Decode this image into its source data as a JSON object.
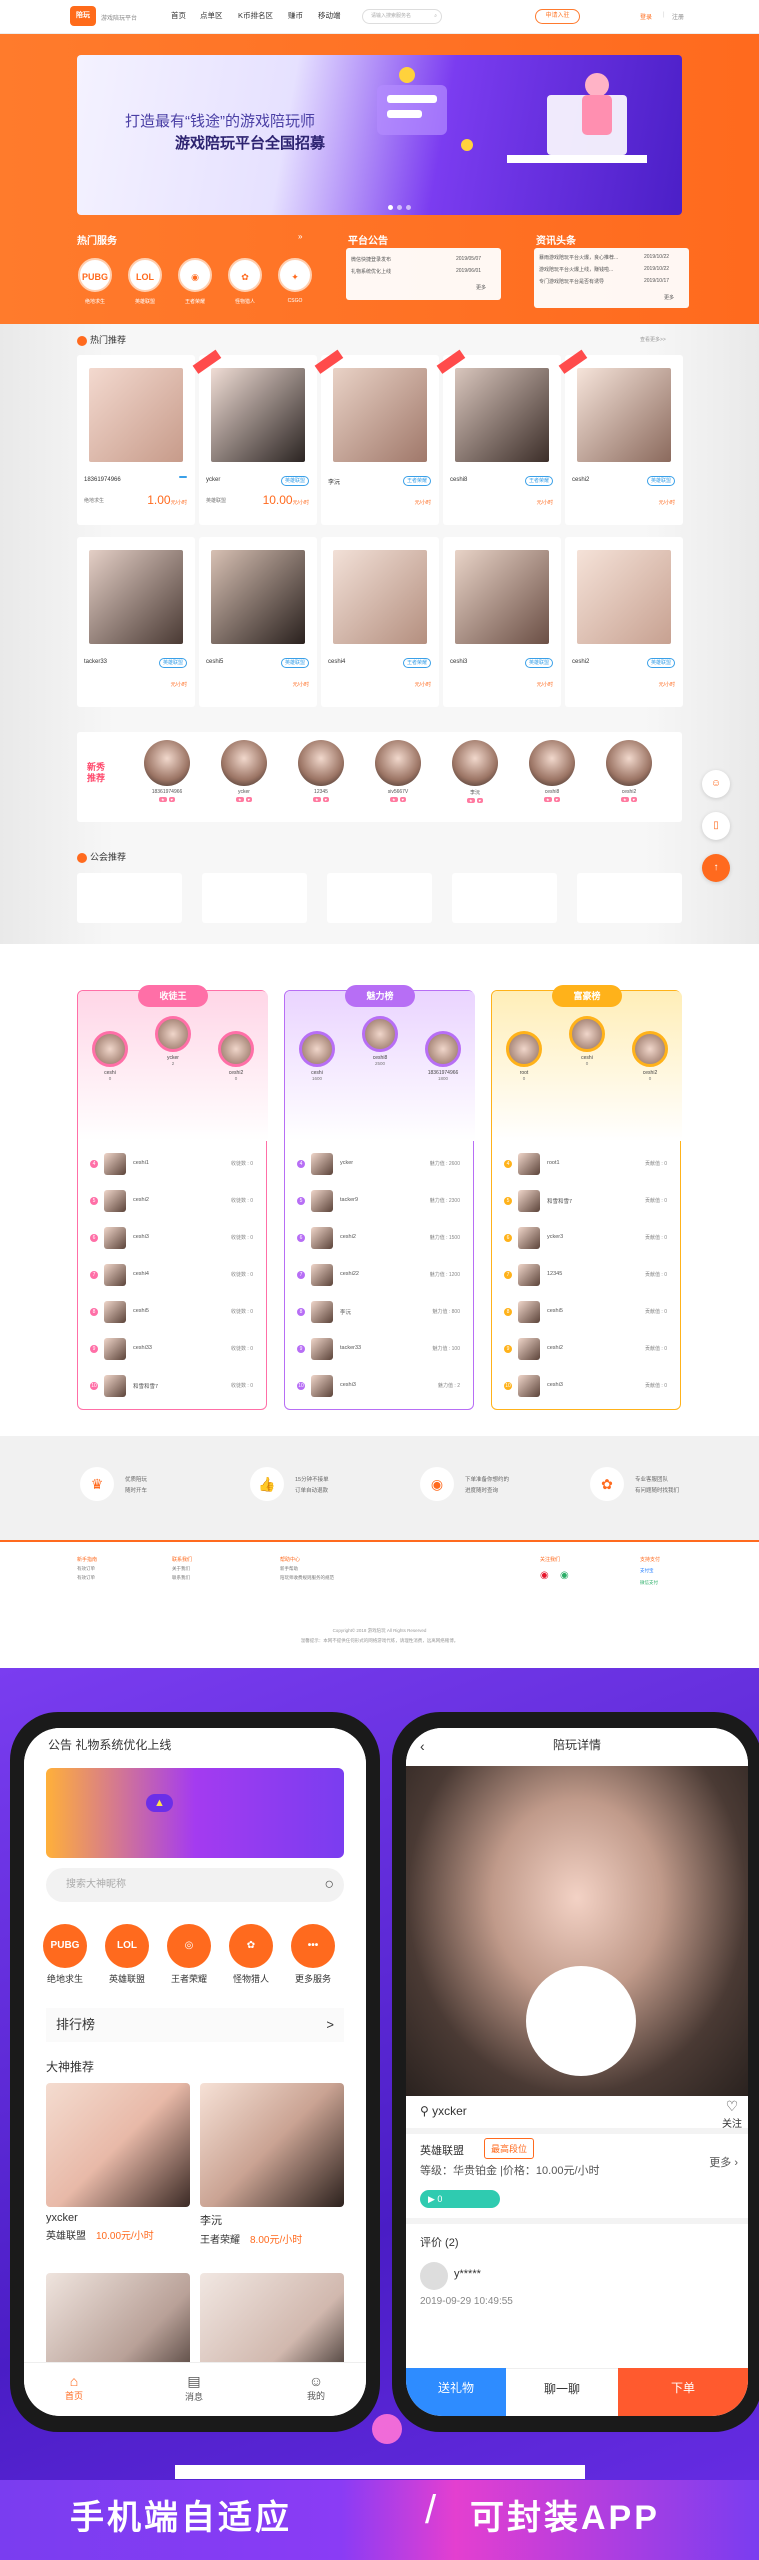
{
  "header": {
    "logo": "陪玩",
    "logo_sub": "游戏陪玩平台",
    "nav": [
      "首页",
      "点单区",
      "K币排名区",
      "赚币",
      "移动端"
    ],
    "search_placeholder": "请输入搜索服务名",
    "join": "申请入驻",
    "login": "登录",
    "register": "注册"
  },
  "banner": {
    "line1": "打造最有“钱途”的游戏陪玩师",
    "line2": "游戏陪玩平台全国招募"
  },
  "services": {
    "title": "热门服务",
    "items": [
      {
        "icon": "PUBG",
        "label": "绝地求生"
      },
      {
        "icon": "LOL",
        "label": "英雄联盟"
      },
      {
        "icon": "◉",
        "label": "王者荣耀"
      },
      {
        "icon": "✿",
        "label": "怪物猎人"
      },
      {
        "icon": "✦",
        "label": "CSGO"
      }
    ]
  },
  "notice": {
    "title": "平台公告",
    "items": [
      {
        "t": "微信快捷登录发布",
        "d": "2019/05/07"
      },
      {
        "t": "礼物系统优化上线",
        "d": "2019/06/01"
      }
    ],
    "more": "更多"
  },
  "news": {
    "title": "资讯头条",
    "items": [
      {
        "t": "暴雨游戏陪玩平台火爆，良心推荐...",
        "d": "2019/10/22"
      },
      {
        "t": "游戏陪玩平台火爆上线，赚钱啦...",
        "d": "2019/10/22"
      },
      {
        "t": "专门游戏陪玩平台是否有诱导",
        "d": "2019/10/17"
      }
    ],
    "more": "更多"
  },
  "hot": {
    "title": "热门推荐",
    "more": "查看更多>>",
    "cards": [
      {
        "name": "18361974966",
        "badge": "",
        "game": "绝地求生",
        "price": "1.00",
        "unit": "元/小时"
      },
      {
        "name": "ycker",
        "badge": "英雄联盟",
        "game": "英雄联盟",
        "price": "10.00",
        "unit": "元/小时"
      },
      {
        "name": "李沅",
        "badge": "王者荣耀",
        "game": "",
        "price": "0",
        "unit": "元/小时"
      },
      {
        "name": "ceshi8",
        "badge": "王者荣耀",
        "game": "",
        "price": "0",
        "unit": "元/小时"
      },
      {
        "name": "ceshi2",
        "badge": "英雄联盟",
        "game": "",
        "price": "0",
        "unit": "元/小时"
      },
      {
        "name": "tacker33",
        "badge": "英雄联盟",
        "game": "",
        "price": "0",
        "unit": "元/小时"
      },
      {
        "name": "ceshi5",
        "badge": "英雄联盟",
        "game": "",
        "price": "0",
        "unit": "元/小时"
      },
      {
        "name": "ceshi4",
        "badge": "王者荣耀",
        "game": "",
        "price": "0",
        "unit": "元/小时"
      },
      {
        "name": "ceshi3",
        "badge": "英雄联盟",
        "game": "",
        "price": "0",
        "unit": "元/小时"
      },
      {
        "name": "ceshi2",
        "badge": "英雄联盟",
        "game": "",
        "price": "0",
        "unit": "元/小时"
      }
    ]
  },
  "newrec": {
    "title": "新秀推荐",
    "items": [
      "18361974966",
      "ycker",
      "12345",
      "siv5667V",
      "李沅",
      "ceshi8",
      "ceshi2"
    ]
  },
  "guild": {
    "title": "公会推荐"
  },
  "ranks": [
    {
      "title": "收徒王",
      "top3": [
        {
          "n": "ceshi",
          "v": "0"
        },
        {
          "n": "ycker",
          "v": "2"
        },
        {
          "n": "ceshi2",
          "v": "0"
        }
      ],
      "rows": [
        {
          "n": "ceshi1",
          "v": "0"
        },
        {
          "n": "ceshi2",
          "v": "0"
        },
        {
          "n": "ceshi3",
          "v": "0"
        },
        {
          "n": "ceshi4",
          "v": "0"
        },
        {
          "n": "ceshi5",
          "v": "0"
        },
        {
          "n": "ceshi33",
          "v": "0"
        },
        {
          "n": "和雪和雪7",
          "v": "0"
        }
      ],
      "vlabel": "收徒数"
    },
    {
      "title": "魅力榜",
      "top3": [
        {
          "n": "ceshi",
          "v": "1600"
        },
        {
          "n": "ceshi8",
          "v": "2500"
        },
        {
          "n": "18361974966",
          "v": "1800"
        }
      ],
      "rows": [
        {
          "n": "ycker",
          "v": "2600"
        },
        {
          "n": "tacker9",
          "v": "2300"
        },
        {
          "n": "ceshi2",
          "v": "1500"
        },
        {
          "n": "ceshi22",
          "v": "1200"
        },
        {
          "n": "李沅",
          "v": "800"
        },
        {
          "n": "tacker33",
          "v": "100"
        },
        {
          "n": "ceshi3",
          "v": "2"
        }
      ],
      "vlabel": "魅力值"
    },
    {
      "title": "富豪榜",
      "top3": [
        {
          "n": "root",
          "v": "0"
        },
        {
          "n": "ceshi",
          "v": "0"
        },
        {
          "n": "ceshi2",
          "v": "0"
        }
      ],
      "rows": [
        {
          "n": "root1",
          "v": "0"
        },
        {
          "n": "和雪和雪7",
          "v": "0"
        },
        {
          "n": "ycker3",
          "v": "0"
        },
        {
          "n": "12345",
          "v": "0"
        },
        {
          "n": "ceshi5",
          "v": "0"
        },
        {
          "n": "ceshi2",
          "v": "0"
        },
        {
          "n": "ceshi3",
          "v": "0"
        }
      ],
      "vlabel": "贡献值"
    }
  ],
  "features": [
    {
      "icon": "♛",
      "a": "优质陪玩",
      "b": "随时开车"
    },
    {
      "icon": "👍",
      "a": "15分钟不接单",
      "b": "订单自动退款"
    },
    {
      "icon": "◉",
      "a": "下单准备你想约的",
      "b": "进度随时查询"
    },
    {
      "icon": "✿",
      "a": "专业客服团队",
      "b": "有问题随时找我们"
    }
  ],
  "footer": {
    "cols": [
      {
        "t": "新手指南",
        "s": [
          "有效订单",
          "有效订单"
        ]
      },
      {
        "t": "联系我们",
        "s": [
          "关于我们",
          "联系我们"
        ]
      },
      {
        "t": "帮助中心",
        "s": [
          "新手帮助",
          "陪玩师收费规则服务的规范"
        ]
      },
      {
        "t": "关注我们",
        "s": []
      },
      {
        "t": "支持支付",
        "s": [
          "支付宝",
          "微信支付"
        ]
      }
    ],
    "copy1": "Copyright© 2018 游戏陪玩 All Rights Reserved",
    "copy2": "温馨提示：本网不提供任何形式的网络游戏代练，请理性消费，远离网络赌博。"
  },
  "mobile": {
    "notice": "公告   礼物系统优化上线",
    "detail_title": "陪玩详情",
    "search": "搜索大神昵称",
    "icons": [
      {
        "i": "PUBG",
        "l": "绝地求生"
      },
      {
        "i": "LOL",
        "l": "英雄联盟"
      },
      {
        "i": "◎",
        "l": "王者荣耀"
      },
      {
        "i": "✿",
        "l": "怪物猎人"
      },
      {
        "i": "•••",
        "l": "更多服务"
      }
    ],
    "rank": "排行榜",
    "gods": "大神推荐",
    "cards": [
      {
        "n": "yxcker",
        "g": "英雄联盟",
        "p": "10.00元/小时"
      },
      {
        "n": "李沅",
        "g": "王者荣耀",
        "p": "8.00元/小时"
      }
    ],
    "tabs": [
      "首页",
      "消息",
      "我的"
    ],
    "d_name": "yxcker",
    "d_follow": "关注",
    "d_game": "英雄联盟",
    "d_rank": "最高段位",
    "d_level": "等级：华贵铂金 |价格：10.00元/小时",
    "d_more": "更多",
    "d_voice": "0",
    "d_eval": "评价 (2)",
    "d_user": "y*****",
    "d_date": "2019-09-29 10:49:55",
    "d_gift": "送礼物",
    "d_chat": "聊一聊",
    "d_order": "下单"
  },
  "slogan": {
    "a": "手机端自适应",
    "b": "可封装APP"
  }
}
